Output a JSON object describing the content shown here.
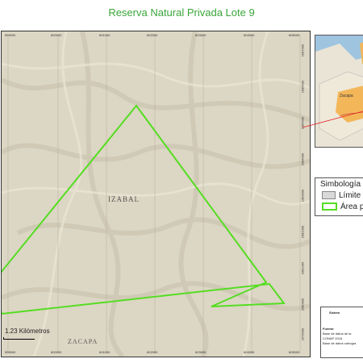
{
  "title": "Reserva Natural Privada Lote 9",
  "map": {
    "labels": {
      "izabal": "IZABAL",
      "zacapa": "ZACAPA"
    },
    "top_ticks": [
      "599000",
      "600000",
      "601000",
      "602000",
      "603000",
      "604000",
      "605000"
    ],
    "bottom_ticks": [
      "599000",
      "600000",
      "601000",
      "602000",
      "603000",
      "604000",
      "605000"
    ],
    "right_ticks": [
      "1687000",
      "1686000",
      "1685000",
      "1684000",
      "1683000",
      "1682000",
      "1681000",
      "1680000",
      "1679000"
    ],
    "scale_label": "1.23 Kilómetros",
    "polygon_color": "#55dd22",
    "background_color": "#dcd6c4"
  },
  "inset": {
    "region_label": "Zacapa"
  },
  "legend": {
    "title": "Simbología",
    "items": [
      {
        "label": "Límite",
        "color": "#d9d9d9"
      },
      {
        "label": "Área pr",
        "color": "#55dd22"
      }
    ]
  },
  "info": {
    "title": "Sistem",
    "lines": [
      "Fuente:",
      "Base de datos de la",
      "CONAP 2016",
      "Base de datos cartogra"
    ]
  }
}
